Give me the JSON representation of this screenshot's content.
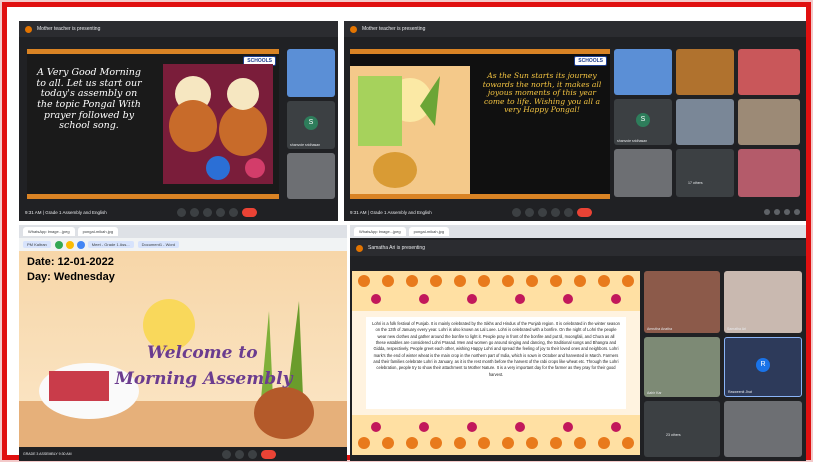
{
  "top_left": {
    "presenting": "Mother teacher is presenting",
    "logo": "SCHOOLS",
    "slide_text": "A Very Good Morning to all. Let us start our today's assembly on the topic Pongal With prayer followed by school song.",
    "time": "9:31 AM",
    "meeting": "Grade 1 Assembly and English",
    "tile_name": "shanvoie sridhasan",
    "avatar_letter": "S"
  },
  "top_right": {
    "presenting": "Mother teacher is presenting",
    "logo": "SCHOOLS",
    "slide_text": "As the Sun starts its journey towards the north, it makes all joyous moments of this year come to life. Wishing you all a very Happy Pongal!",
    "time": "9:31 AM",
    "meeting": "Grade 1 Assembly and English",
    "tile_name": "shanvoie sridhasan",
    "avatar_letter": "S",
    "others": "17 others"
  },
  "bottom_left": {
    "tabs": [
      "WhatsApp Image...jpeg",
      "pongal-mikah.jpg"
    ],
    "taskbar": [
      "PM Kaltran",
      "Meet - Grade 1 Ass...",
      "Document1 - Word"
    ],
    "date": "Date: 12-01-2022",
    "day": "Day: Wednesday",
    "welcome_line1": "Welcome to",
    "welcome_line2": "Morning Assembly",
    "footer_left": "GRADE 3 ASSEMBLY 9:30 AM"
  },
  "bottom_right": {
    "tabs": [
      "WhatsApp Image...jpeg",
      "pongal-mikah.jpg"
    ],
    "presenting": "Samatha Ari is presenting",
    "lohri_text": "Lohri is a folk festival of Punjab. It is mainly celebrated by the Sikhs and Hindus of the Punjab region. It is celebrated in the winter season on the 13th of January every year. Lohri is also known as Lal Loee. Lohri is celebrated with a bonfire. On the night of Lohri the people wear new clothes and gather around the bonfire to light it. People pray in front of the bonfire and put til, moongfali, and Chura as all these eatables are considered Lohri Prasad. Men and women go around singing and dancing, the traditional songs and Bhangra and Gidda, respectively. People greet each other, wishing Happy Lohri and spread the feeling of joy to their loved ones and neighbors. Lohri mark's the end of winter wheat is the main crop in the northern part of India, which is sown in October and harvested in March. Farmers and their families celebrate Lohri in January, as it is the rest month before the harvest of the rabi crops like wheat etc. Through the Lohri celebration, people try to show their attachment to Mother Nature. It is a very important day for the farmer as they pray for their good harvest.",
    "tiles": [
      "Amrutha Anatha",
      "Samatha Ari",
      "Aahir Kar",
      "Rasweenit Jhat"
    ],
    "others": "23 others",
    "avatar_letter": "R"
  }
}
